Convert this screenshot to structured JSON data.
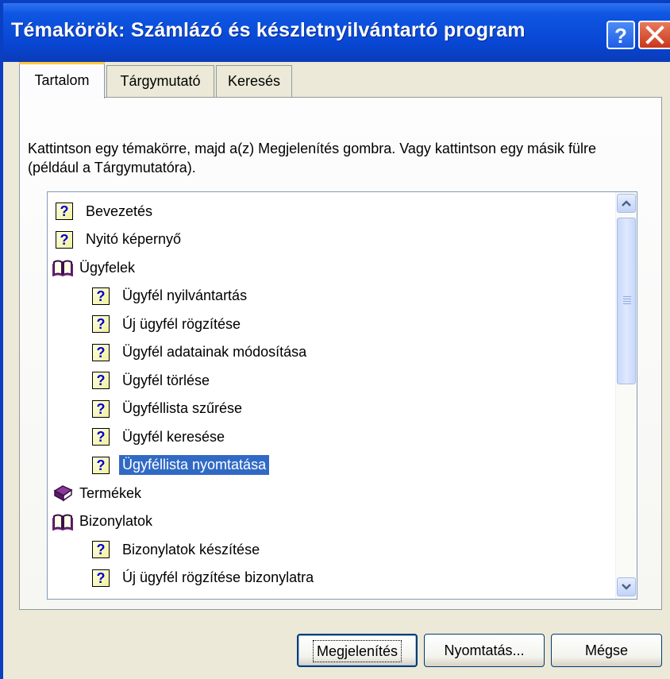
{
  "window": {
    "title": "Témakörök: Számlázó és készletnyilvántartó program"
  },
  "tabs": [
    {
      "label": "Tartalom"
    },
    {
      "label": "Tárgymutató"
    },
    {
      "label": "Keresés"
    }
  ],
  "instructions": "Kattintson egy témakörre, majd a(z) Megjelenítés gombra. Vagy kattintson egy másik fülre (például a Tárgymutatóra).",
  "tree": {
    "items": [
      {
        "label": "Bevezetés",
        "icon": "help-page-icon",
        "level": 0
      },
      {
        "label": "Nyitó képernyő",
        "icon": "help-page-icon",
        "level": 0
      },
      {
        "label": "Ügyfelek",
        "icon": "open-book-icon",
        "level": 0
      },
      {
        "label": "Ügyfél nyilvántartás",
        "icon": "help-page-icon",
        "level": 1
      },
      {
        "label": "Új ügyfél rögzítése",
        "icon": "help-page-icon",
        "level": 1
      },
      {
        "label": "Ügyfél adatainak módosítása",
        "icon": "help-page-icon",
        "level": 1
      },
      {
        "label": "Ügyfél törlése",
        "icon": "help-page-icon",
        "level": 1
      },
      {
        "label": "Ügyféllista szűrése",
        "icon": "help-page-icon",
        "level": 1
      },
      {
        "label": "Ügyfél keresése",
        "icon": "help-page-icon",
        "level": 1
      },
      {
        "label": "Ügyféllista nyomtatása",
        "icon": "help-page-icon",
        "level": 1,
        "selected": true
      },
      {
        "label": "Termékek",
        "icon": "closed-book-icon",
        "level": 0
      },
      {
        "label": "Bizonylatok",
        "icon": "open-book-icon",
        "level": 0
      },
      {
        "label": "Bizonylatok készítése",
        "icon": "help-page-icon",
        "level": 1
      },
      {
        "label": "Új ügyfél rögzítése bizonylatra",
        "icon": "help-page-icon",
        "level": 1
      }
    ]
  },
  "buttons": {
    "display": "Megjelenítés",
    "print": "Nyomtatás...",
    "cancel": "Mégse"
  },
  "colors": {
    "titlebar": "#0846d2",
    "selection": "#316ac5",
    "dialog_bg": "#ece9d8"
  }
}
